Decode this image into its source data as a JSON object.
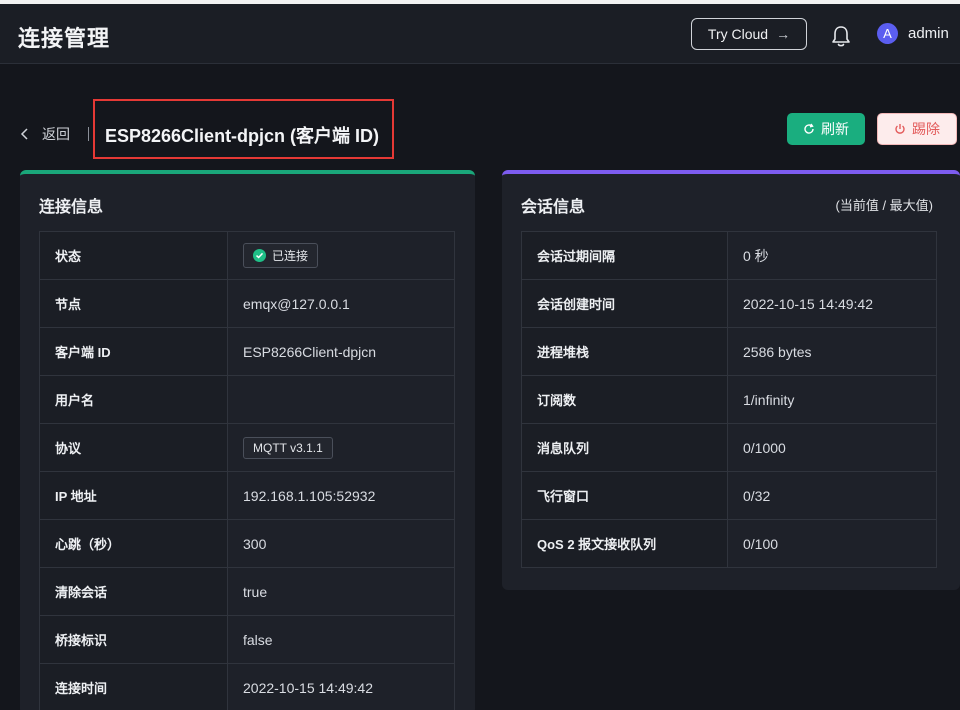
{
  "header": {
    "title": "连接管理",
    "try_cloud": "Try Cloud",
    "avatar_letter": "A",
    "username": "admin"
  },
  "toolbar": {
    "back_label": "返回",
    "client_title": "ESP8266Client-dpjcn (客户端 ID)",
    "refresh_label": "刷新",
    "kick_label": "踢除"
  },
  "connection_info": {
    "title": "连接信息",
    "rows": [
      {
        "key": "状态",
        "value": "已连接"
      },
      {
        "key": "节点",
        "value": "emqx@127.0.0.1"
      },
      {
        "key": "客户端 ID",
        "value": "ESP8266Client-dpjcn"
      },
      {
        "key": "用户名",
        "value": ""
      },
      {
        "key": "协议",
        "value": "MQTT v3.1.1"
      },
      {
        "key": "IP 地址",
        "value": "192.168.1.105:52932"
      },
      {
        "key": "心跳（秒）",
        "value": "300"
      },
      {
        "key": "清除会话",
        "value": "true"
      },
      {
        "key": "桥接标识",
        "value": "false"
      },
      {
        "key": "连接时间",
        "value": "2022-10-15 14:49:42"
      }
    ]
  },
  "session_info": {
    "title": "会话信息",
    "hint": "(当前值 / 最大值)",
    "rows": [
      {
        "key": "会话过期间隔",
        "value": "0 秒"
      },
      {
        "key": "会话创建时间",
        "value": "2022-10-15 14:49:42"
      },
      {
        "key": "进程堆栈",
        "value": "2586 bytes"
      },
      {
        "key": "订阅数",
        "value": "1/infinity"
      },
      {
        "key": "消息队列",
        "value": "0/1000"
      },
      {
        "key": "飞行窗口",
        "value": "0/32"
      },
      {
        "key": "QoS 2 报文接收队列",
        "value": "0/100"
      }
    ]
  },
  "colors": {
    "primary": "#1aae7f",
    "danger": "#e35b5b",
    "accent_purple": "#7d5cf0",
    "background": "#14161c"
  }
}
